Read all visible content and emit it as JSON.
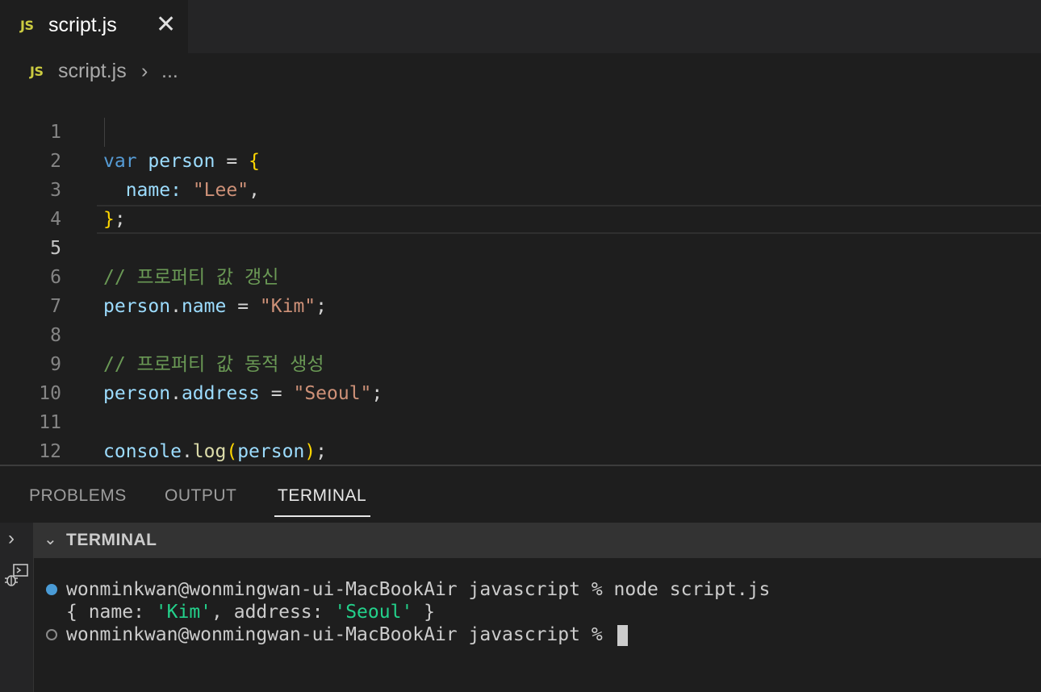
{
  "tab": {
    "icon": "JS",
    "title": "script.js",
    "close": "✕"
  },
  "breadcrumb": {
    "icon": "JS",
    "file": "script.js",
    "separator": "›",
    "more": "..."
  },
  "editor": {
    "lines": [
      {
        "n": "1"
      },
      {
        "n": "2"
      },
      {
        "n": "3"
      },
      {
        "n": "4"
      },
      {
        "n": "5"
      },
      {
        "n": "6"
      },
      {
        "n": "7"
      },
      {
        "n": "8"
      },
      {
        "n": "9"
      },
      {
        "n": "10"
      },
      {
        "n": "11"
      },
      {
        "n": "12"
      }
    ],
    "code": {
      "l1": {
        "kw": "var",
        "name": "person",
        "eq": "=",
        "brace": "{"
      },
      "l2": {
        "prop": "name",
        "colon": ":",
        "str": "\"Lee\"",
        "comma": ","
      },
      "l3": {
        "brace": "}",
        "semi": ";"
      },
      "l5": {
        "comment": "// 프로퍼티 값 갱신"
      },
      "l6": {
        "obj": "person",
        "dot": ".",
        "prop": "name",
        "eq": "=",
        "str": "\"Kim\"",
        "semi": ";"
      },
      "l8": {
        "comment": "// 프로퍼티 값 동적 생성"
      },
      "l9": {
        "obj": "person",
        "dot": ".",
        "prop": "address",
        "eq": "=",
        "str": "\"Seoul\"",
        "semi": ";"
      },
      "l11": {
        "obj": "console",
        "dot": ".",
        "fn": "log",
        "open": "(",
        "arg": "person",
        "close": ")",
        "semi": ";"
      }
    }
  },
  "panel": {
    "tabs": [
      "PROBLEMS",
      "OUTPUT",
      "TERMINAL"
    ],
    "active_tab": "TERMINAL",
    "terminal_header": "TERMINAL",
    "terminal": {
      "line1": "wonminkwan@wonmingwan-ui-MacBookAir javascript % node script.js",
      "out_open": "{ name: ",
      "out_name": "'Kim'",
      "out_mid": ", address: ",
      "out_addr": "'Seoul'",
      "out_close": " }",
      "line3": "wonminkwan@wonmingwan-ui-MacBookAir javascript % "
    }
  },
  "colors": {
    "keyword": "#569cd6",
    "variable": "#9cdcfe",
    "string": "#ce9178",
    "comment": "#6a9955",
    "function": "#dcdcaa",
    "bracket": "#ffd700",
    "js_icon": "#cbcb41"
  }
}
